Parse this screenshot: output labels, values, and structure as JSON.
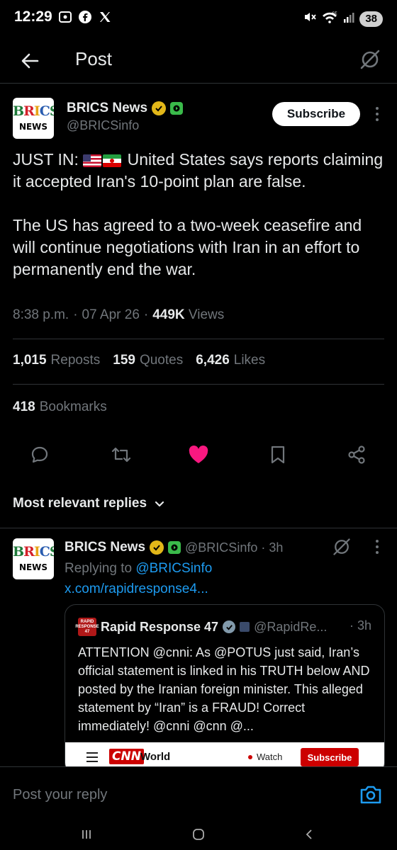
{
  "status_bar": {
    "time": "12:29",
    "battery": "38"
  },
  "header": {
    "title": "Post"
  },
  "post": {
    "author_name": "BRICS News",
    "handle": "@BRICSinfo",
    "avatar_text_top": "BRICS",
    "avatar_text_bottom": "NEWS",
    "subscribe_label": "Subscribe",
    "text_prefix": "JUST IN: ",
    "text_flags": [
      "us-flag-icon",
      "iran-flag-icon"
    ],
    "text_line1_rest": " United States says reports claiming it accepted Iran's 10-point plan are false.",
    "text_para2": "The US has agreed to a two-week ceasefire and will continue negotiations with Iran in an effort to permanently end the war.",
    "time": "8:38 p.m.",
    "date": "07 Apr 26",
    "views_count": "449K",
    "views_label": "Views",
    "reposts_count": "1,015",
    "reposts_label": "Reposts",
    "quotes_count": "159",
    "quotes_label": "Quotes",
    "likes_count": "6,426",
    "likes_label": "Likes",
    "bookmarks_count": "418",
    "bookmarks_label": "Bookmarks",
    "liked": true
  },
  "replies_filter": {
    "label": "Most relevant replies"
  },
  "reply": {
    "author_name": "BRICS News",
    "handle_time": "@BRICSinfo · 3h",
    "replying_prefix": "Replying to ",
    "replying_handle": "@BRICSinfo",
    "link": "x.com/rapidresponse4...",
    "quote": {
      "author_name": "Rapid Response 47",
      "handle": "@RapidRe...",
      "time": "· 3h",
      "avatar_text": "RAPID RESPONSE 47",
      "text": "ATTENTION @cnni: As @POTUS just said, Iran’s official statement is linked in his TRUTH below AND posted by the Iranian foreign minister. This alleged statement by “Iran” is a FRAUD! Correct immediately! @cnni @cnn @...",
      "cnn": {
        "logo": "CNN",
        "section": "World",
        "watch": "Watch",
        "subscribe": "Subscribe"
      }
    }
  },
  "composer": {
    "placeholder": "Post your reply"
  },
  "colors": {
    "background": "#000000",
    "text": "#e7e9ea",
    "muted": "#71767b",
    "link": "#1d9bf0",
    "like": "#f91880",
    "divider": "#2f3336"
  }
}
